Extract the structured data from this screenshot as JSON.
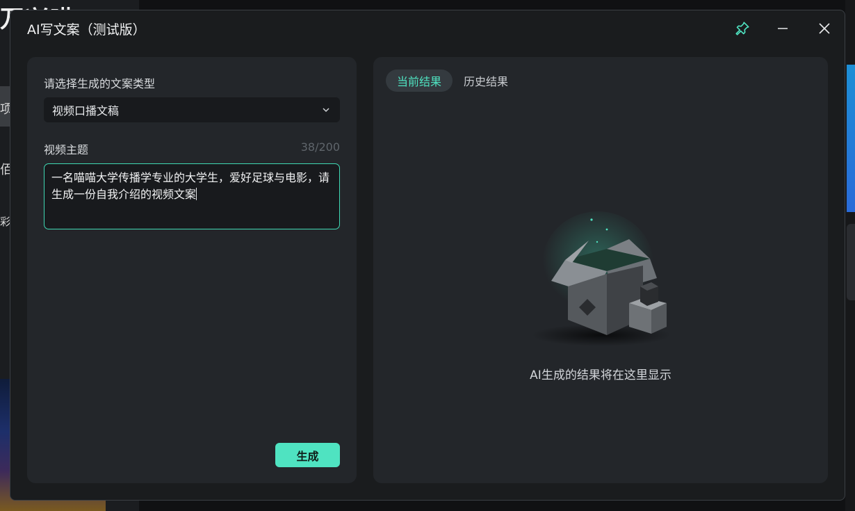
{
  "background": {
    "left_title_fragment": "万兴喵",
    "left_items": [
      "项",
      "佰",
      "彩"
    ]
  },
  "dialog": {
    "title": "AI写文案（测试版）",
    "header_icons": [
      "pin-icon",
      "minimize-icon",
      "close-icon"
    ]
  },
  "left_panel": {
    "type_label": "请选择生成的文案类型",
    "type_select": {
      "selected": "视频口播文稿"
    },
    "topic_label": "视频主题",
    "counter": "38/200",
    "topic_text": "一名喵喵大学传播学专业的大学生，爱好足球与电影，请生成一份自我介绍的视频文案",
    "generate_label": "生成"
  },
  "right_panel": {
    "tabs": [
      {
        "label": "当前结果",
        "active": true
      },
      {
        "label": "历史结果",
        "active": false
      }
    ],
    "empty_text": "AI生成的结果将在这里显示"
  },
  "colors": {
    "accent": "#4fe3c1",
    "dialog_bg": "#1a1c1e",
    "panel_bg": "#23262a"
  }
}
